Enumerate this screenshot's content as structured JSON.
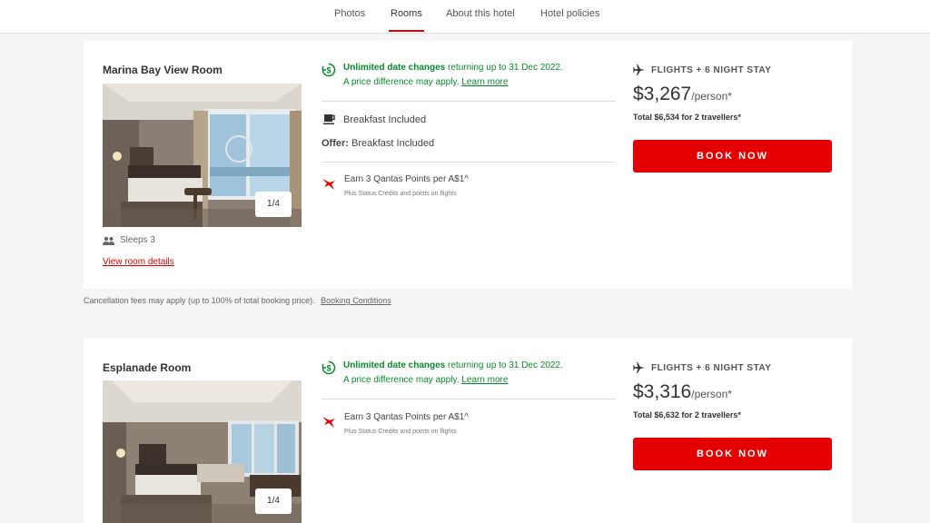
{
  "nav": {
    "tabs": [
      {
        "label": "Photos"
      },
      {
        "label": "Rooms"
      },
      {
        "label": "About this hotel"
      },
      {
        "label": "Hotel policies"
      }
    ],
    "active_tab": "Rooms",
    "accent_color": "#e40000"
  },
  "rooms": [
    {
      "name": "Marina Bay View Room",
      "photo_counter": "1/4",
      "sleeps": "Sleeps 3",
      "details_link": "View room details",
      "date_change_bold": "Unlimited date changes",
      "date_change_rest": " returning up to 31 Dec 2022.",
      "price_diff": "A price difference may apply.",
      "learn_more": "Learn more",
      "inclusion": "Breakfast Included",
      "offer_label": "Offer:",
      "offer_value": "Breakfast Included",
      "points": "Earn 3 Qantas Points per A$1^",
      "points_sub": "Plus Status Credits and points on flights",
      "package": "FLIGHTS + 6 NIGHT STAY",
      "price": "$3,267",
      "per": "/person*",
      "total": "Total $6,534 for 2 travellers*",
      "book": "BOOK NOW"
    },
    {
      "name": "Esplanade Room",
      "photo_counter": "1/4",
      "date_change_bold": "Unlimited date changes",
      "date_change_rest": " returning up to 31 Dec 2022.",
      "price_diff": "A price difference may apply.",
      "learn_more": "Learn more",
      "points": "Earn 3 Qantas Points per A$1^",
      "points_sub": "Plus Status Credits and points on flights",
      "package": "FLIGHTS + 6 NIGHT STAY",
      "price": "$3,316",
      "per": "/person*",
      "total": "Total $6,632 for 2 travellers*",
      "book": "BOOK NOW"
    }
  ],
  "cancellation": {
    "text": "Cancellation fees may apply (up to 100% of total booking price).",
    "link": "Booking Conditions"
  },
  "icons": {
    "date_change": "dollar-cycle-icon",
    "inclusion": "coffee-cup-icon",
    "points": "qantas-kangaroo-icon",
    "package": "plane-icon",
    "sleeps": "people-icon"
  },
  "colors": {
    "green": "#0a8a2e",
    "red": "#e40000"
  }
}
